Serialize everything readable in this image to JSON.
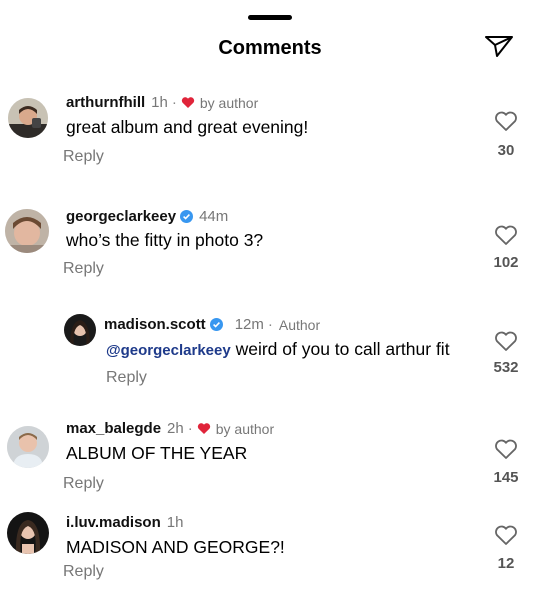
{
  "sheet": {
    "title": "Comments",
    "share_icon": "paper-plane-icon"
  },
  "colors": {
    "heart_red": "#e0243a",
    "verified_blue": "#3897f0",
    "mention_blue": "#1e3a8a",
    "secondary_text": "#777777"
  },
  "comments": [
    {
      "username": "arthurnfhill",
      "verified": false,
      "time": "1h",
      "liked_by_author": true,
      "liked_by_author_label": "by author",
      "text": "great album and great evening!",
      "reply_label": "Reply",
      "like_count": "30"
    },
    {
      "username": "georgeclarkeey",
      "verified": true,
      "time": "44m",
      "liked_by_author": false,
      "text": "who’s the fitty in photo 3?",
      "reply_label": "Reply",
      "like_count": "102"
    },
    {
      "username": "madison.scott",
      "verified": true,
      "time": "12m",
      "author_label": "Author",
      "is_reply": true,
      "mention": "@georgeclarkeey",
      "text": "weird of you to call arthur fit",
      "reply_label": "Reply",
      "like_count": "532"
    },
    {
      "username": "max_balegde",
      "verified": false,
      "time": "2h",
      "liked_by_author": true,
      "liked_by_author_label": "by author",
      "text": "ALBUM OF THE YEAR",
      "reply_label": "Reply",
      "like_count": "145"
    },
    {
      "username": "i.luv.madison",
      "verified": false,
      "time": "1h",
      "liked_by_author": false,
      "text": "MADISON AND GEORGE?!",
      "reply_label": "Reply",
      "like_count": "12"
    }
  ]
}
